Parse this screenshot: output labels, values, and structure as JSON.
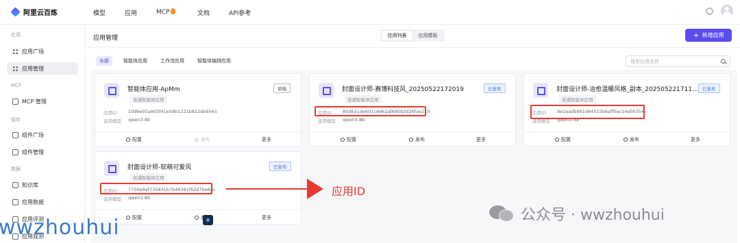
{
  "brand": {
    "name": "阿里云百炼"
  },
  "topnav": {
    "items": [
      "模型",
      "应用",
      "MCP",
      "文档",
      "API参考"
    ]
  },
  "sidebar": {
    "sections": [
      {
        "label": "应用",
        "items": [
          "应用广场",
          "应用管理"
        ]
      },
      {
        "label": "MCP",
        "items": [
          "MCP 管理"
        ]
      },
      {
        "label": "组件",
        "items": [
          "组件广场",
          "组件管理"
        ]
      },
      {
        "label": "数据",
        "items": [
          "知识库",
          "应用数据",
          "应用评测",
          "应用观测"
        ]
      }
    ],
    "active": "应用管理"
  },
  "page": {
    "title": "应用管理",
    "view_toggle": [
      "应用列表",
      "应用模板"
    ],
    "new_button": "新增应用",
    "filters": [
      "全部",
      "智能体应用",
      "工作流应用",
      "智能体编排应用"
    ],
    "search_placeholder": "搜索应用名称"
  },
  "cards": [
    {
      "title": "智能体应用-ApMm",
      "type": "普通智能体应用",
      "status": "草稿",
      "status_kind": "draft",
      "id_label": "应用ID",
      "id": "10d6e05a8d3f41e58b1221b822de9565",
      "model_label": "选用模型",
      "model": "qwen3-8b",
      "actions": [
        "配置",
        "发布",
        "更多"
      ],
      "publish_disabled": true
    },
    {
      "title": "封面设计师-赛博科技风_20250522172019",
      "type": "普通智能体应用",
      "status": "已发布",
      "status_kind": "published",
      "id_label": "应用ID",
      "id": "80d631de601c4962af69092d26fae110",
      "model_label": "选用模型",
      "model": "qwen3-8b",
      "actions": [
        "配置",
        "发布",
        "更多"
      ],
      "publish_disabled": false
    },
    {
      "title": "封面设计师-治愈温暖风格_副本_202505221711...",
      "type": "普通智能体应用",
      "status": "已发布",
      "status_kind": "published",
      "id_label": "应用ID",
      "id": "9e1eadb991d64515b6aff5ec14e00354",
      "model_label": "选用模型",
      "model": "qwen3-8b",
      "actions": [
        "配置",
        "发布",
        "更多"
      ],
      "publish_disabled": false
    },
    {
      "title": "封面设计师-软萌可爱风",
      "type": "普通智能体应用",
      "status": "已发布",
      "status_kind": "published",
      "id_label": "应用ID",
      "id": "7704e9af735841b7b48361f62d7be68c",
      "model_label": "选用模型",
      "model": "qwen3-8b",
      "actions": [
        "配置",
        "发布",
        "更多"
      ],
      "publish_disabled": false
    }
  ],
  "annotation": {
    "label": "应用ID",
    "color": "#e8382f"
  },
  "watermark": {
    "account": "公众号 · wwzhouhui",
    "left_text": "wwzhouhui"
  },
  "colors": {
    "accent": "#5b4cf0",
    "published": "#3a6ff0",
    "highlight": "#e8382f"
  }
}
